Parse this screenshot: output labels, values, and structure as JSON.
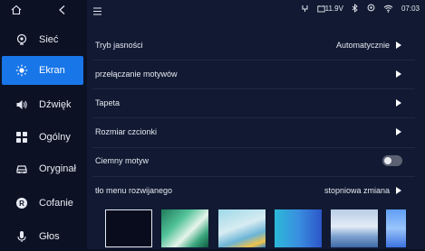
{
  "sidebar": {
    "items": [
      {
        "label": "Sieć",
        "icon": "network-icon"
      },
      {
        "label": "Ekran",
        "icon": "brightness-icon",
        "active": true
      },
      {
        "label": "Dźwięk",
        "icon": "speaker-icon"
      },
      {
        "label": "Ogólny",
        "icon": "grid-icon"
      },
      {
        "label": "Oryginał",
        "icon": "car-icon"
      },
      {
        "label": "Cofanie",
        "icon": "reverse-icon"
      },
      {
        "label": "Głos",
        "icon": "microphone-icon"
      }
    ]
  },
  "status": {
    "voltage": "11.9V",
    "time": "07:03"
  },
  "settings": {
    "brightness_mode": {
      "label": "Tryb jasności",
      "value": "Automatycznie"
    },
    "theme_switch": {
      "label": "przełączanie motywów"
    },
    "wallpaper": {
      "label": "Tapeta"
    },
    "font_size": {
      "label": "Rozmiar czcionki"
    },
    "dark_theme": {
      "label": "Ciemny motyw",
      "enabled": false
    },
    "menu_background": {
      "label": "tło menu rozwijanego",
      "value": "stopniowa zmiana"
    }
  },
  "colors": {
    "accent": "#1976e8",
    "background": "#111a32",
    "sidebar": "#0c1224"
  }
}
